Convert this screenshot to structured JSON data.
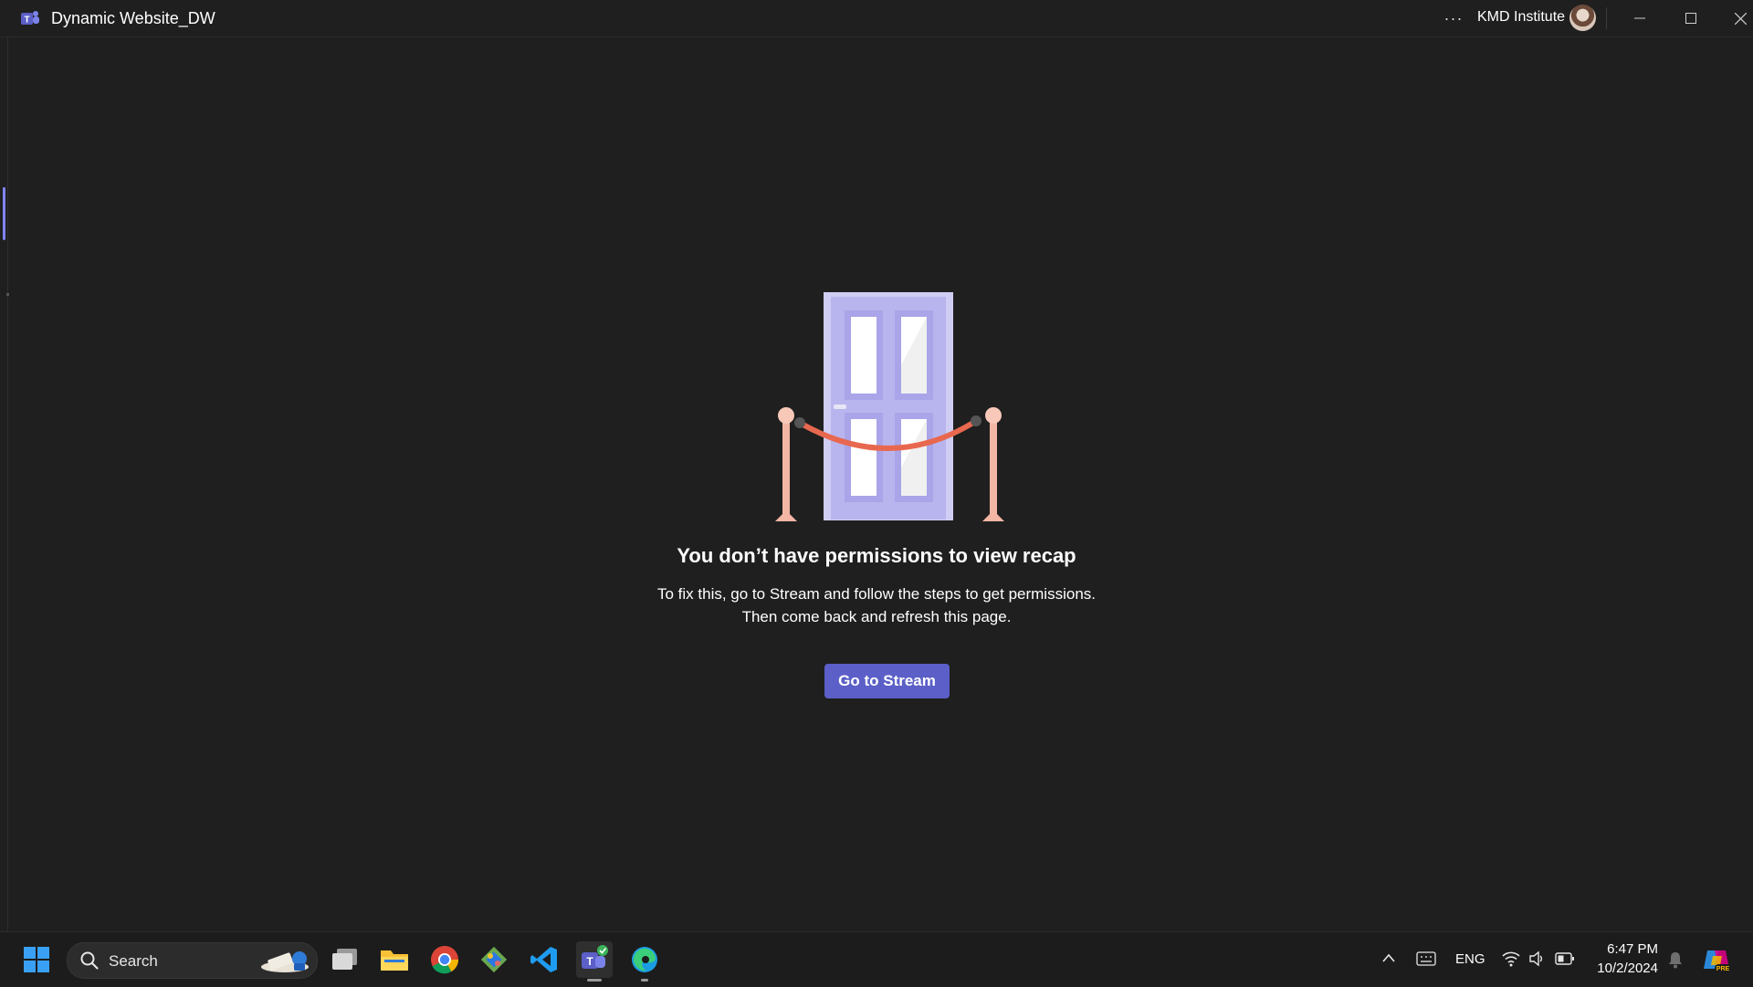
{
  "window": {
    "title": "Dynamic Website_DW",
    "more_label": "···",
    "org_name": "KMD Institute"
  },
  "content": {
    "headline": "You don’t have permissions to view recap",
    "description_line1": "To fix this, go to Stream and follow the steps to get permissions.",
    "description_line2": "Then come back and refresh this page.",
    "button_label": "Go to Stream"
  },
  "taskbar": {
    "search_label": "Search",
    "language": "ENG",
    "time": "6:47 PM",
    "date": "10/2/2024",
    "apps": [
      "start-icon",
      "file-manager-icon",
      "folder-icon",
      "chrome-icon",
      "git-icon",
      "vscode-icon",
      "teams-icon",
      "edge-icon"
    ]
  },
  "colors": {
    "background": "#1f1f1f",
    "accent": "#5b5fc7",
    "door": "#cfcdf3",
    "rope": "#e8684f",
    "post": "#f3b5a4"
  }
}
